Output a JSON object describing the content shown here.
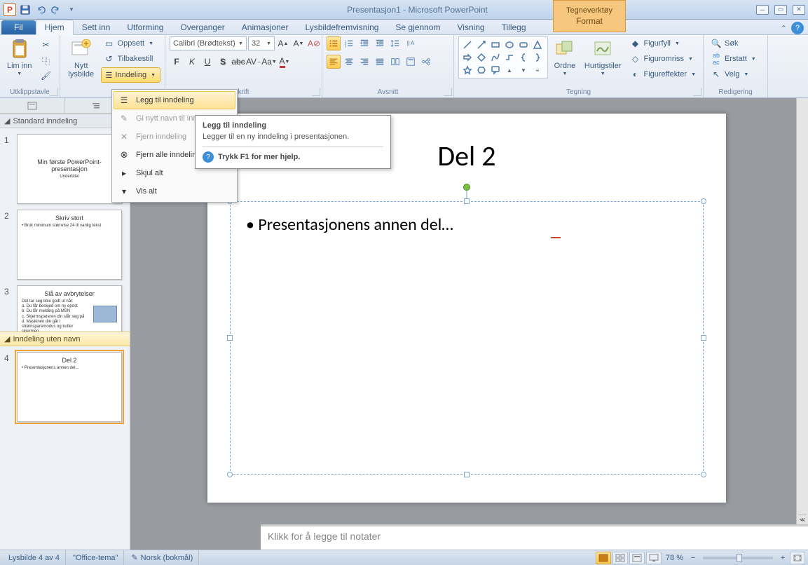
{
  "title": "Presentasjon1 - Microsoft PowerPoint",
  "context_tool": {
    "group": "Tegneverktøy",
    "tab": "Format"
  },
  "tabs": {
    "file": "Fil",
    "items": [
      "Hjem",
      "Sett inn",
      "Utforming",
      "Overganger",
      "Animasjoner",
      "Lysbildefremvisning",
      "Se gjennom",
      "Visning",
      "Tillegg"
    ],
    "active": "Hjem"
  },
  "ribbon": {
    "clipboard": {
      "label": "Utklippstavle",
      "paste": "Lim inn"
    },
    "slides": {
      "label": "",
      "new": "Nytt lysbilde",
      "layout": "Oppsett",
      "reset": "Tilbakestill",
      "section": "Inndeling"
    },
    "font": {
      "label": "krift",
      "name": "Calibri (Brødtekst)",
      "size": "32"
    },
    "paragraph": {
      "label": "Avsnitt"
    },
    "drawing": {
      "label": "Tegning",
      "arrange": "Ordne",
      "quick": "Hurtigstiler",
      "fill": "Figurfyll",
      "outline": "Figuromriss",
      "effects": "Figureffekter"
    },
    "editing": {
      "label": "Redigering",
      "find": "Søk",
      "replace": "Erstatt",
      "select": "Velg"
    }
  },
  "dropdown": {
    "items": [
      {
        "label": "Legg til inndeling",
        "state": "hover"
      },
      {
        "label": "Gi nytt navn til inndeling",
        "state": "disabled"
      },
      {
        "label": "Fjern inndeling",
        "state": "disabled"
      },
      {
        "label": "Fjern alle inndelinger",
        "state": "enabled"
      },
      {
        "label": "Skjul alt",
        "state": "enabled"
      },
      {
        "label": "Vis alt",
        "state": "enabled"
      }
    ]
  },
  "tooltip": {
    "title": "Legg til inndeling",
    "desc": "Legger til en ny inndeling i presentasjonen.",
    "help": "Trykk F1 for mer hjelp."
  },
  "outline": {
    "section1": "Standard inndeling",
    "section2": "Inndeling uten navn",
    "slides": [
      {
        "n": "1",
        "title": "Min første PowerPoint-presentasjon",
        "sub": "Undertittel"
      },
      {
        "n": "2",
        "title": "Skriv stort",
        "body": "• Bruk minimum størrelse 24 til vanlig tekst"
      },
      {
        "n": "3",
        "title": "Slå av avbrytelser",
        "body": "Det tar seg ikke godt ut når:\na. Du får beskjed om ny epost\nb. Du får melding på MSN\nc. Skjermspareren din slår seg på\nd. Maskinen din går i strømsparemodus og kutter skjermen\n\nSør for at dette og eventuelt andre tilsvarende ting er slått av."
      },
      {
        "n": "4",
        "title": "Del 2",
        "body": "• Presentasjonens  annen del...",
        "selected": true
      }
    ]
  },
  "slide": {
    "title": "Del 2",
    "bullet": "• Presentasjonens annen del…"
  },
  "notes_placeholder": "Klikk for å legge til notater",
  "status": {
    "slide": "Lysbilde 4 av 4",
    "theme": "\"Office-tema\"",
    "lang": "Norsk (bokmål)",
    "zoom": "78 %"
  }
}
